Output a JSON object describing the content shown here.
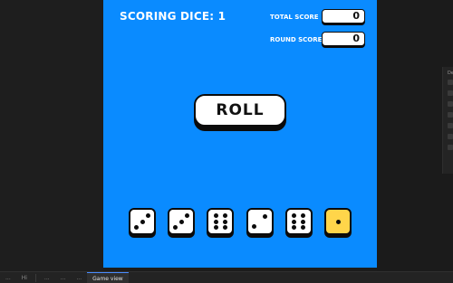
{
  "game": {
    "scoring_dice_label": "SCORING DICE: 1",
    "total_score_label": "TOTAL SCORE",
    "total_score_value": "0",
    "round_score_label": "ROUND SCORE",
    "round_score_value": "0",
    "roll_label": "ROLL",
    "colors": {
      "background": "#0a8bff",
      "die_face": "#ffffff",
      "die_held": "#ffd54a",
      "outline": "#0b0b0b"
    },
    "dice": [
      {
        "value": 3,
        "held": false
      },
      {
        "value": 3,
        "held": false
      },
      {
        "value": 6,
        "held": false
      },
      {
        "value": 2,
        "held": false
      },
      {
        "value": 6,
        "held": false
      },
      {
        "value": 1,
        "held": true
      }
    ]
  },
  "editor": {
    "right_panel_title": "De",
    "taskbar": [
      {
        "label": "...",
        "active": false
      },
      {
        "label": "Hi",
        "active": false
      },
      {
        "label": "...",
        "active": false
      },
      {
        "label": "...",
        "active": false
      },
      {
        "label": "...",
        "active": false
      },
      {
        "label": "Game view",
        "active": true
      }
    ]
  }
}
